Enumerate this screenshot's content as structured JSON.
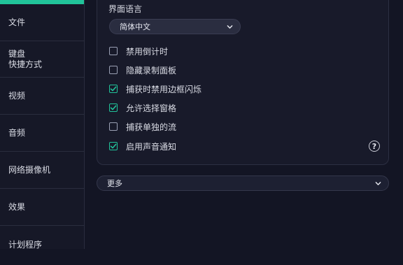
{
  "colors": {
    "accent": "#21c39a",
    "background": "#131524",
    "panel": "#181a2a"
  },
  "sidebar": {
    "items": [
      {
        "label": "文件"
      },
      {
        "label": "键盘\n快捷方式"
      },
      {
        "label": "视频"
      },
      {
        "label": "音频"
      },
      {
        "label": "网络摄像机"
      },
      {
        "label": "效果"
      },
      {
        "label": "计划程序"
      }
    ]
  },
  "language": {
    "label": "界面语言",
    "selected": "简体中文",
    "icon": "chevron-down-icon"
  },
  "options": [
    {
      "label": "禁用倒计时",
      "checked": false
    },
    {
      "label": "隐藏录制面板",
      "checked": false
    },
    {
      "label": "捕获时禁用边框闪烁",
      "checked": true
    },
    {
      "label": "允许选择窗格",
      "checked": true
    },
    {
      "label": "捕获单独的流",
      "checked": false
    },
    {
      "label": "启用声音通知",
      "checked": true
    }
  ],
  "help": {
    "icon": "help-icon",
    "symbol": "?"
  },
  "more": {
    "label": "更多",
    "icon": "chevron-down-icon"
  }
}
